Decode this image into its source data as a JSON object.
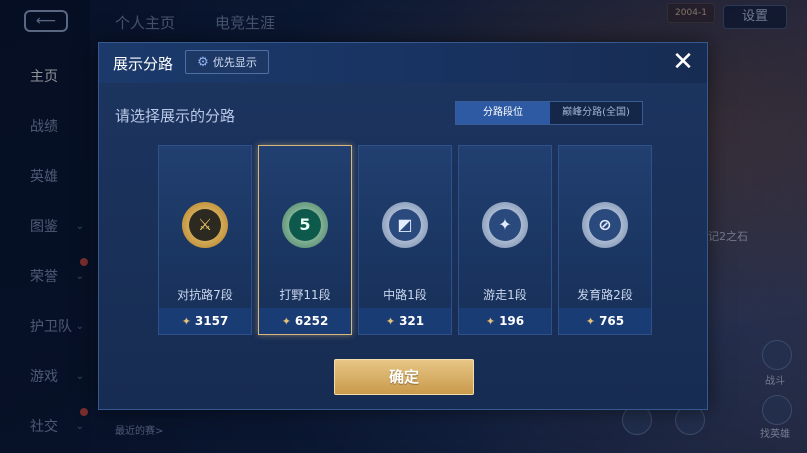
{
  "top_tabs": [
    "个人主页",
    "电竞生涯"
  ],
  "settings_label": "设置",
  "id_badge": "2004-1",
  "left_nav": [
    {
      "label": "主页",
      "active": true
    },
    {
      "label": "战绩"
    },
    {
      "label": "英雄"
    },
    {
      "label": "图鉴"
    },
    {
      "label": "荣誉"
    },
    {
      "label": "护卫队"
    },
    {
      "label": "游戏"
    },
    {
      "label": "社交"
    }
  ],
  "recent": "最近的赛>",
  "side_right": [
    "记2之石",
    "战斗",
    "找英雄"
  ],
  "dialog": {
    "title": "展示分路",
    "priority_label": "优先显示",
    "subtitle": "请选择展示的分路",
    "toggle": [
      "分路段位",
      "巅峰分路(全国)"
    ],
    "confirm_label": "确定",
    "close_glyph": "✕"
  },
  "cards": [
    {
      "label": "对抗路7段",
      "points": "3157",
      "emblem_color": "#d8a43f",
      "glyph": "⚔"
    },
    {
      "label": "打野11段",
      "points": "6252",
      "emblem_color": "#1d9b84",
      "glyph": "5",
      "selected": true
    },
    {
      "label": "中路1段",
      "points": "321",
      "emblem_color": "#7f96b8",
      "glyph": "◩"
    },
    {
      "label": "游走1段",
      "points": "196",
      "emblem_color": "#7f96b8",
      "glyph": "✦"
    },
    {
      "label": "发育路2段",
      "points": "765",
      "emblem_color": "#7f96b8",
      "glyph": "⊘"
    }
  ],
  "colors": {
    "accent": "#2e5aa4",
    "gold": "#d9b77b",
    "confirm": "#c99a4b"
  }
}
